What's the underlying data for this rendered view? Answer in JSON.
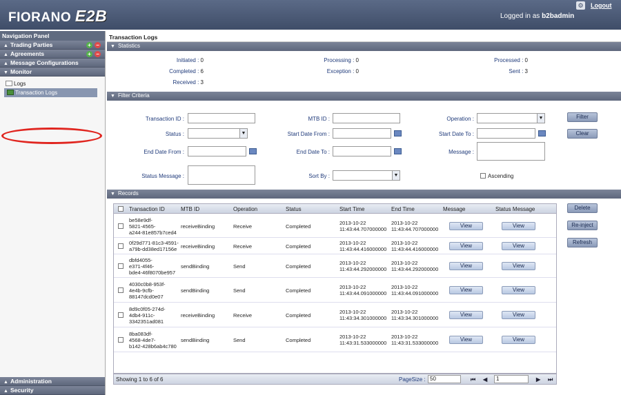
{
  "header": {
    "logo_main": "FIORANO",
    "logo_accent": "E2B",
    "logout_label": "Logout",
    "logged_in_prefix": "Logged in as",
    "username": "b2badmin"
  },
  "nav": {
    "title": "Navigation Panel",
    "sections": {
      "trading_parties": "Trading Parties",
      "agreements": "Agreements",
      "message_configurations": "Message Configurations",
      "monitor": "Monitor",
      "administration": "Administration",
      "security": "Security"
    },
    "monitor_items": [
      "Logs",
      "Transaction Logs"
    ]
  },
  "main": {
    "title": "Transaction Logs",
    "statistics": {
      "header": "Statistics",
      "initiated_label": "Initiated :",
      "initiated": "0",
      "completed_label": "Completed :",
      "completed": "6",
      "received_label": "Received :",
      "received": "3",
      "processing_label": "Processing :",
      "processing": "0",
      "exception_label": "Exception :",
      "exception": "0",
      "processed_label": "Processed :",
      "processed": "0",
      "sent_label": "Sent :",
      "sent": "3"
    },
    "filter": {
      "header": "Filter Criteria",
      "transaction_id": "Transaction ID :",
      "mtb_id": "MTB ID :",
      "operation": "Operation :",
      "status": "Status :",
      "start_date_from": "Start Date From :",
      "start_date_to": "Start Date To :",
      "end_date_from": "End Date From :",
      "end_date_to": "End Date To :",
      "message": "Message :",
      "status_message": "Status Message :",
      "sort_by": "Sort By :",
      "ascending": "Ascending",
      "filter_button": "Filter",
      "clear_button": "Clear"
    },
    "records": {
      "header": "Records",
      "columns": [
        "Transaction ID",
        "MTB ID",
        "Operation",
        "Status",
        "Start Time",
        "End Time",
        "Message",
        "Status Message"
      ],
      "rows": [
        {
          "tid": [
            "be58e9df-",
            "5821-4565-",
            "a244-81e857b7ced4"
          ],
          "mtb": "receiveBinding",
          "op": "Receive",
          "status": "Completed",
          "start": [
            "2013-10-22",
            "11:43:44.707000000"
          ],
          "end": [
            "2013-10-22",
            "11:43:44.707000000"
          ],
          "msg": "View",
          "smsg": "View"
        },
        {
          "tid": [
            "0f29d771-81c3-4591-",
            "a79b-dd38ed17156e"
          ],
          "mtb": "receiveBinding",
          "op": "Receive",
          "status": "Completed",
          "start": [
            "2013-10-22",
            "11:43:44.416000000"
          ],
          "end": [
            "2013-10-22",
            "11:43:44.416000000"
          ],
          "msg": "View",
          "smsg": "View"
        },
        {
          "tid": [
            "dbfd4055-",
            "e371-4f46-",
            "bde4-46f8070be957"
          ],
          "mtb": "sendBinding",
          "op": "Send",
          "status": "Completed",
          "start": [
            "2013-10-22",
            "11:43:44.292000000"
          ],
          "end": [
            "2013-10-22",
            "11:43:44.292000000"
          ],
          "msg": "View",
          "smsg": "View"
        },
        {
          "tid": [
            "4030c0b8-953f-",
            "4e4b-9cfb-",
            "88147dcd0e07"
          ],
          "mtb": "sendBinding",
          "op": "Send",
          "status": "Completed",
          "start": [
            "2013-10-22",
            "11:43:44.091000000"
          ],
          "end": [
            "2013-10-22",
            "11:43:44.091000000"
          ],
          "msg": "View",
          "smsg": "View"
        },
        {
          "tid": [
            "8d9c0f05-274d-",
            "4db4-911c-",
            "3342351ad081"
          ],
          "mtb": "receiveBinding",
          "op": "Receive",
          "status": "Completed",
          "start": [
            "2013-10-22",
            "11:43:34.301000000"
          ],
          "end": [
            "2013-10-22",
            "11:43:34.301000000"
          ],
          "msg": "View",
          "smsg": "View"
        },
        {
          "tid": [
            "8ba083df-",
            "4568-4de7-",
            "b142-428b6ab4c780"
          ],
          "mtb": "sendBinding",
          "op": "Send",
          "status": "Completed",
          "start": [
            "2013-10-22",
            "11:43:31.533000000"
          ],
          "end": [
            "2013-10-22",
            "11:43:31.533000000"
          ],
          "msg": "View",
          "smsg": "View"
        }
      ],
      "delete_button": "Delete",
      "reinject_button": "Re-inject",
      "refresh_button": "Refresh",
      "showing": "Showing 1 to 6 of 6",
      "page_size_label": "PageSize :",
      "page_size": "50",
      "page_number": "1"
    }
  }
}
